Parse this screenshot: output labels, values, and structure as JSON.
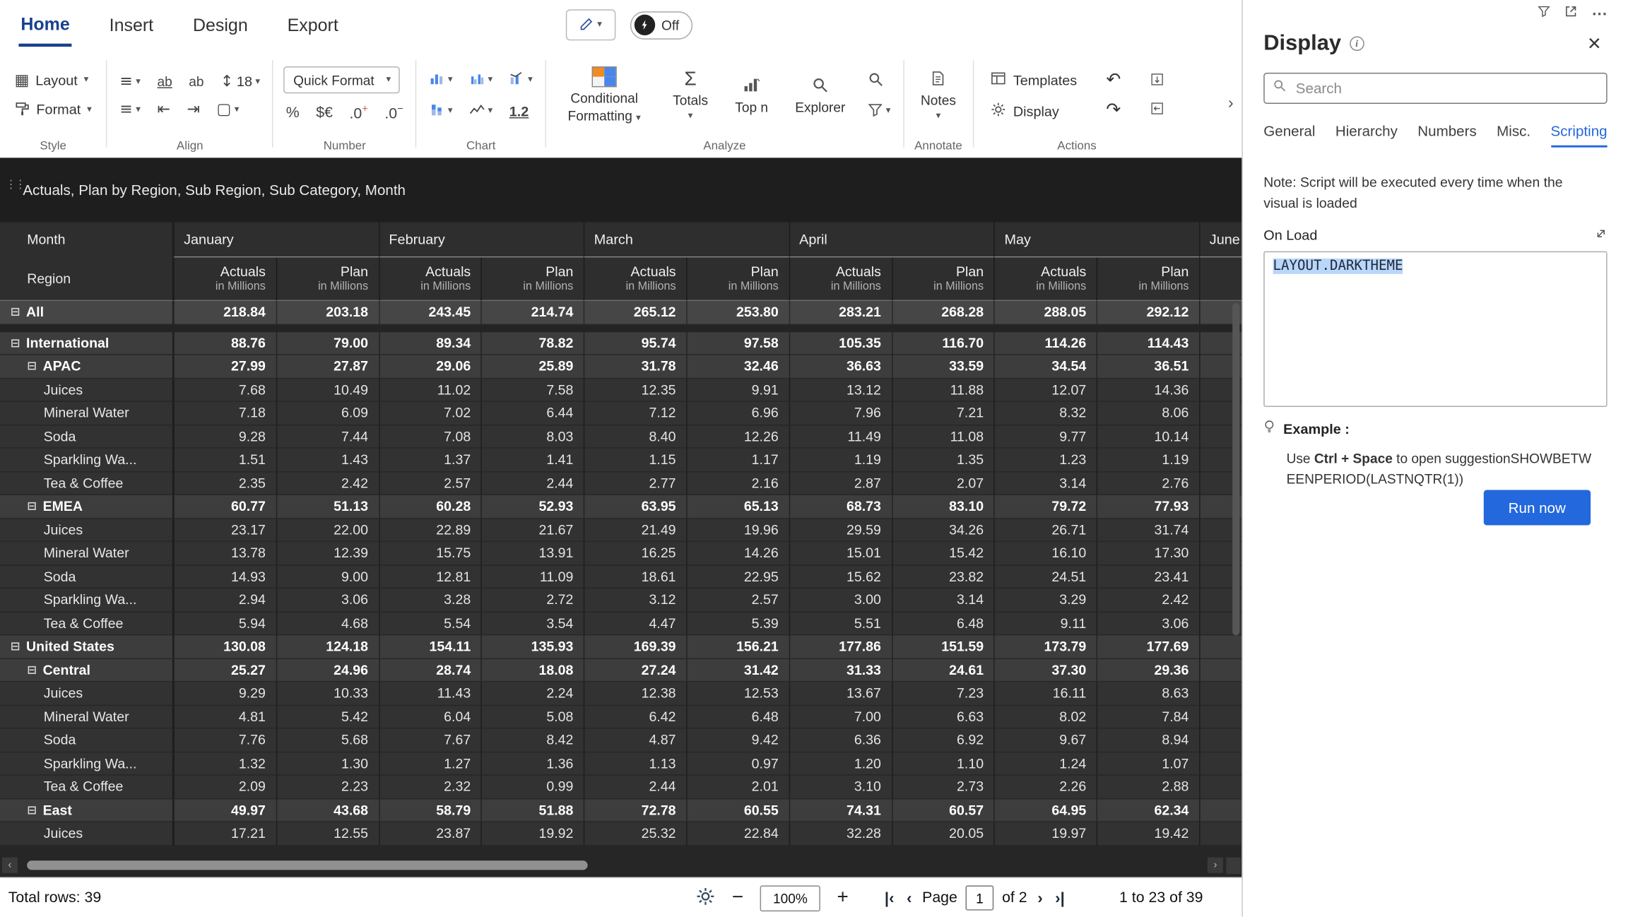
{
  "icons": {
    "caret": "▾",
    "sigma": "Σ",
    "undo": "↶",
    "redo": "↷",
    "more": "⋯",
    "collapse": "⊟",
    "drag": "⋮⋮",
    "chev_right": "›",
    "lines": "≡",
    "ab": "ab",
    "updown": "↕",
    "indent_l": "⇤",
    "indent_r": "⇥",
    "border": "▢",
    "layout": "▦",
    "percent": "%",
    "currency": "$€",
    "dot_zero": ".0",
    "one_two": "1.2",
    "close": "×",
    "info": "i",
    "minus": "−",
    "plus": "+",
    "first": "|‹",
    "prev": "‹",
    "next": "›",
    "last": "›|"
  },
  "menu": {
    "tabs": [
      {
        "label": "Home"
      },
      {
        "label": "Insert"
      },
      {
        "label": "Design"
      },
      {
        "label": "Export"
      }
    ],
    "edit_toggle_label": "Off"
  },
  "ribbon": {
    "style": {
      "label": "Style",
      "layout": "Layout",
      "format": "Format"
    },
    "align": {
      "label": "Align",
      "row_height": "18"
    },
    "number": {
      "label": "Number",
      "quick_format": "Quick Format"
    },
    "chart": {
      "label": "Chart"
    },
    "analyze": {
      "label": "Analyze",
      "conditional_formatting": "Conditional Formatting",
      "totals": "Totals",
      "top_n": "Top n",
      "explorer": "Explorer"
    },
    "annotate": {
      "label": "Annotate",
      "notes": "Notes"
    },
    "actions": {
      "label": "Actions",
      "templates": "Templates",
      "display": "Display"
    }
  },
  "table": {
    "title": "Actuals, Plan by Region, Sub Region, Sub Category, Month",
    "month_header": "Month",
    "region_header": "Region",
    "months": [
      "January",
      "February",
      "March",
      "April",
      "May",
      "June"
    ],
    "measures": [
      "Actuals",
      "Plan"
    ],
    "unit": "in Millions",
    "rows": [
      {
        "label": "All",
        "level": 0,
        "total": true,
        "group": true,
        "values": [
          "218.84",
          "203.18",
          "243.45",
          "214.74",
          "265.12",
          "253.80",
          "283.21",
          "268.28",
          "288.05",
          "292.12"
        ]
      },
      {
        "label": "International",
        "level": 0,
        "group": true,
        "values": [
          "88.76",
          "79.00",
          "89.34",
          "78.82",
          "95.74",
          "97.58",
          "105.35",
          "116.70",
          "114.26",
          "114.43"
        ]
      },
      {
        "label": "APAC",
        "level": 1,
        "group": true,
        "values": [
          "27.99",
          "27.87",
          "29.06",
          "25.89",
          "31.78",
          "32.46",
          "36.63",
          "33.59",
          "34.54",
          "36.51"
        ]
      },
      {
        "label": "Juices",
        "level": 2,
        "values": [
          "7.68",
          "10.49",
          "11.02",
          "7.58",
          "12.35",
          "9.91",
          "13.12",
          "11.88",
          "12.07",
          "14.36"
        ]
      },
      {
        "label": "Mineral Water",
        "level": 2,
        "values": [
          "7.18",
          "6.09",
          "7.02",
          "6.44",
          "7.12",
          "6.96",
          "7.96",
          "7.21",
          "8.32",
          "8.06"
        ]
      },
      {
        "label": "Soda",
        "level": 2,
        "values": [
          "9.28",
          "7.44",
          "7.08",
          "8.03",
          "8.40",
          "12.26",
          "11.49",
          "11.08",
          "9.77",
          "10.14"
        ]
      },
      {
        "label": "Sparkling Wa...",
        "level": 2,
        "values": [
          "1.51",
          "1.43",
          "1.37",
          "1.41",
          "1.15",
          "1.17",
          "1.19",
          "1.35",
          "1.23",
          "1.19"
        ]
      },
      {
        "label": "Tea & Coffee",
        "level": 2,
        "values": [
          "2.35",
          "2.42",
          "2.57",
          "2.44",
          "2.77",
          "2.16",
          "2.87",
          "2.07",
          "3.14",
          "2.76"
        ]
      },
      {
        "label": "EMEA",
        "level": 1,
        "group": true,
        "values": [
          "60.77",
          "51.13",
          "60.28",
          "52.93",
          "63.95",
          "65.13",
          "68.73",
          "83.10",
          "79.72",
          "77.93"
        ]
      },
      {
        "label": "Juices",
        "level": 2,
        "values": [
          "23.17",
          "22.00",
          "22.89",
          "21.67",
          "21.49",
          "19.96",
          "29.59",
          "34.26",
          "26.71",
          "31.74"
        ]
      },
      {
        "label": "Mineral Water",
        "level": 2,
        "values": [
          "13.78",
          "12.39",
          "15.75",
          "13.91",
          "16.25",
          "14.26",
          "15.01",
          "15.42",
          "16.10",
          "17.30"
        ]
      },
      {
        "label": "Soda",
        "level": 2,
        "values": [
          "14.93",
          "9.00",
          "12.81",
          "11.09",
          "18.61",
          "22.95",
          "15.62",
          "23.82",
          "24.51",
          "23.41"
        ]
      },
      {
        "label": "Sparkling Wa...",
        "level": 2,
        "values": [
          "2.94",
          "3.06",
          "3.28",
          "2.72",
          "3.12",
          "2.57",
          "3.00",
          "3.14",
          "3.29",
          "2.42"
        ]
      },
      {
        "label": "Tea & Coffee",
        "level": 2,
        "values": [
          "5.94",
          "4.68",
          "5.54",
          "3.54",
          "4.47",
          "5.39",
          "5.51",
          "6.48",
          "9.11",
          "3.06"
        ]
      },
      {
        "label": "United States",
        "level": 0,
        "group": true,
        "values": [
          "130.08",
          "124.18",
          "154.11",
          "135.93",
          "169.39",
          "156.21",
          "177.86",
          "151.59",
          "173.79",
          "177.69"
        ]
      },
      {
        "label": "Central",
        "level": 1,
        "group": true,
        "values": [
          "25.27",
          "24.96",
          "28.74",
          "18.08",
          "27.24",
          "31.42",
          "31.33",
          "24.61",
          "37.30",
          "29.36"
        ]
      },
      {
        "label": "Juices",
        "level": 2,
        "values": [
          "9.29",
          "10.33",
          "11.43",
          "2.24",
          "12.38",
          "12.53",
          "13.67",
          "7.23",
          "16.11",
          "8.63"
        ]
      },
      {
        "label": "Mineral Water",
        "level": 2,
        "values": [
          "4.81",
          "5.42",
          "6.04",
          "5.08",
          "6.42",
          "6.48",
          "7.00",
          "6.63",
          "8.02",
          "7.84"
        ]
      },
      {
        "label": "Soda",
        "level": 2,
        "values": [
          "7.76",
          "5.68",
          "7.67",
          "8.42",
          "4.87",
          "9.42",
          "6.36",
          "6.92",
          "9.67",
          "8.94"
        ]
      },
      {
        "label": "Sparkling Wa...",
        "level": 2,
        "values": [
          "1.32",
          "1.30",
          "1.27",
          "1.36",
          "1.13",
          "0.97",
          "1.20",
          "1.10",
          "1.24",
          "1.07"
        ]
      },
      {
        "label": "Tea & Coffee",
        "level": 2,
        "values": [
          "2.09",
          "2.23",
          "2.32",
          "0.99",
          "2.44",
          "2.01",
          "3.10",
          "2.73",
          "2.26",
          "2.88"
        ]
      },
      {
        "label": "East",
        "level": 1,
        "group": true,
        "values": [
          "49.97",
          "43.68",
          "58.79",
          "51.88",
          "72.78",
          "60.55",
          "74.31",
          "60.57",
          "64.95",
          "62.34"
        ]
      },
      {
        "label": "Juices",
        "level": 2,
        "values": [
          "17.21",
          "12.55",
          "23.87",
          "19.92",
          "25.32",
          "22.84",
          "32.28",
          "20.05",
          "19.97",
          "19.42"
        ]
      }
    ]
  },
  "status_bar": {
    "total_rows": "Total rows: 39",
    "zoom": "100%",
    "page_label": "Page",
    "page_value": "1",
    "of_label": "of 2",
    "range": "1 to 23 of 39"
  },
  "panel": {
    "title": "Display",
    "search_placeholder": "Search",
    "tabs": [
      {
        "label": "General"
      },
      {
        "label": "Hierarchy"
      },
      {
        "label": "Numbers"
      },
      {
        "label": "Misc."
      },
      {
        "label": "Scripting"
      }
    ],
    "note": "Note: Script will be executed every time when the visual is loaded",
    "on_load": "On Load",
    "script_code": "LAYOUT.DARKTHEME",
    "example_label": "Example :",
    "example_prefix": "Use ",
    "example_keys": "Ctrl + Space",
    "example_mid": " to open suggestion",
    "example_code": "SHOWBETWEENPERIOD(LASTNQTR(1))",
    "run_button": "Run now"
  }
}
